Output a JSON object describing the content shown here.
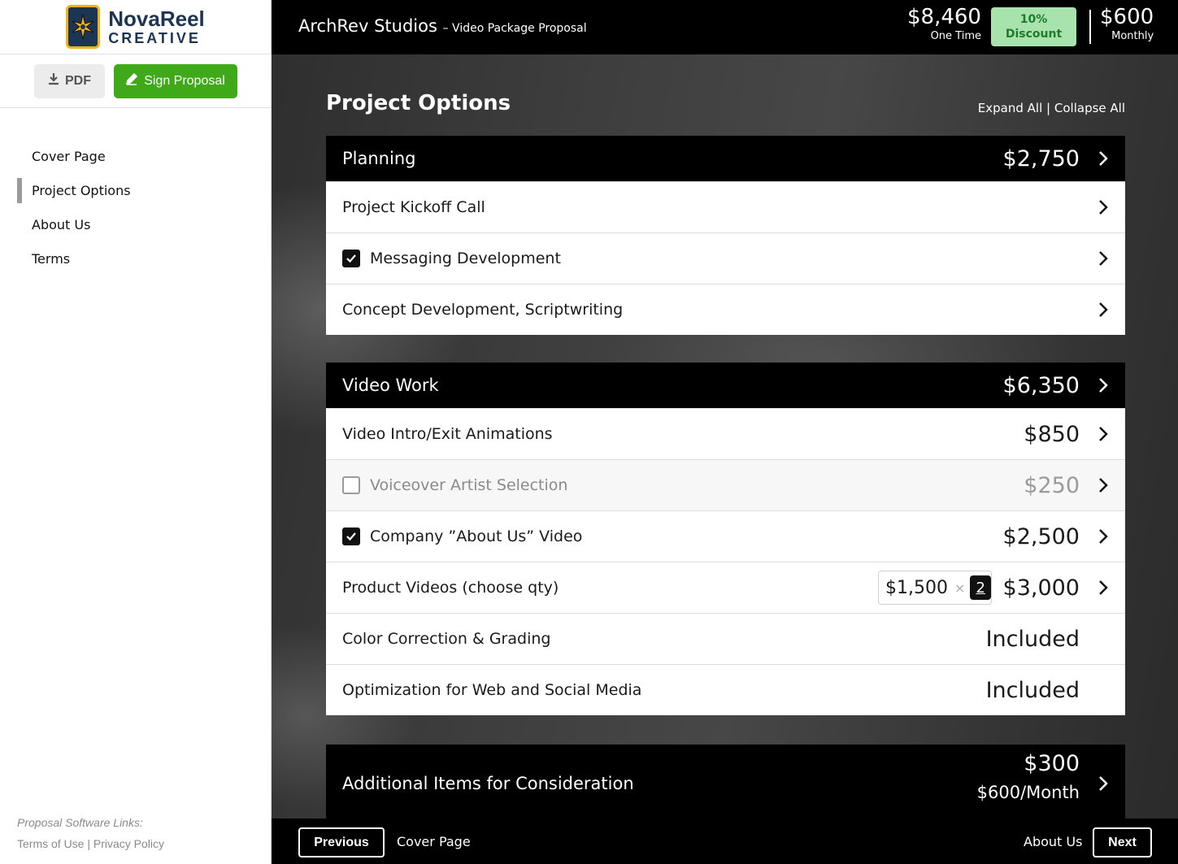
{
  "brand": {
    "name": "NovaReel",
    "sub": "CREATIVE"
  },
  "actions": {
    "pdf_label": "PDF",
    "sign_label": "Sign Proposal"
  },
  "nav": {
    "items": [
      {
        "label": "Cover Page",
        "active": false
      },
      {
        "label": "Project Options",
        "active": true
      },
      {
        "label": "About Us",
        "active": false
      },
      {
        "label": "Terms",
        "active": false
      }
    ]
  },
  "sidebar_footer": {
    "caption": "Proposal Software Links:",
    "terms": "Terms of Use",
    "sep": "|",
    "privacy": "Privacy Policy"
  },
  "header": {
    "client": "ArchRev Studios",
    "subtitle": "– Video Package Proposal",
    "one_time_amount": "$8,460",
    "one_time_label": "One Time",
    "discount_pct": "10%",
    "discount_label": "Discount",
    "monthly_amount": "$600",
    "monthly_label": "Monthly"
  },
  "content": {
    "title": "Project Options",
    "expand_all": "Expand All",
    "separator": "|",
    "collapse_all": "Collapse All"
  },
  "planning": {
    "name": "Planning",
    "price": "$2,750",
    "items": [
      {
        "label": "Project Kickoff Call"
      },
      {
        "label": "Messaging Development",
        "checked": true
      },
      {
        "label": "Concept Development, Scriptwriting"
      }
    ]
  },
  "video_work": {
    "name": "Video Work",
    "price": "$6,350",
    "items": [
      {
        "label": "Video Intro/Exit Animations",
        "price": "$850"
      },
      {
        "label": "Voiceover Artist Selection",
        "price": "$250",
        "checked": false
      },
      {
        "label": "Company ”About Us” Video",
        "price": "$2,500",
        "checked": true
      },
      {
        "label": "Product Videos (choose qty)",
        "unit_price": "$1,500",
        "times": "×",
        "qty": "2",
        "price": "$3,000"
      },
      {
        "label": "Color Correction & Grading",
        "price": "Included"
      },
      {
        "label": "Optimization for Web and Social Media",
        "price": "Included"
      }
    ]
  },
  "additional": {
    "name": "Additional Items for Consideration",
    "price": "$300",
    "monthly": "$600/Month"
  },
  "footer": {
    "previous_label": "Previous",
    "previous_page": "Cover Page",
    "next_page": "About Us",
    "next_label": "Next"
  }
}
